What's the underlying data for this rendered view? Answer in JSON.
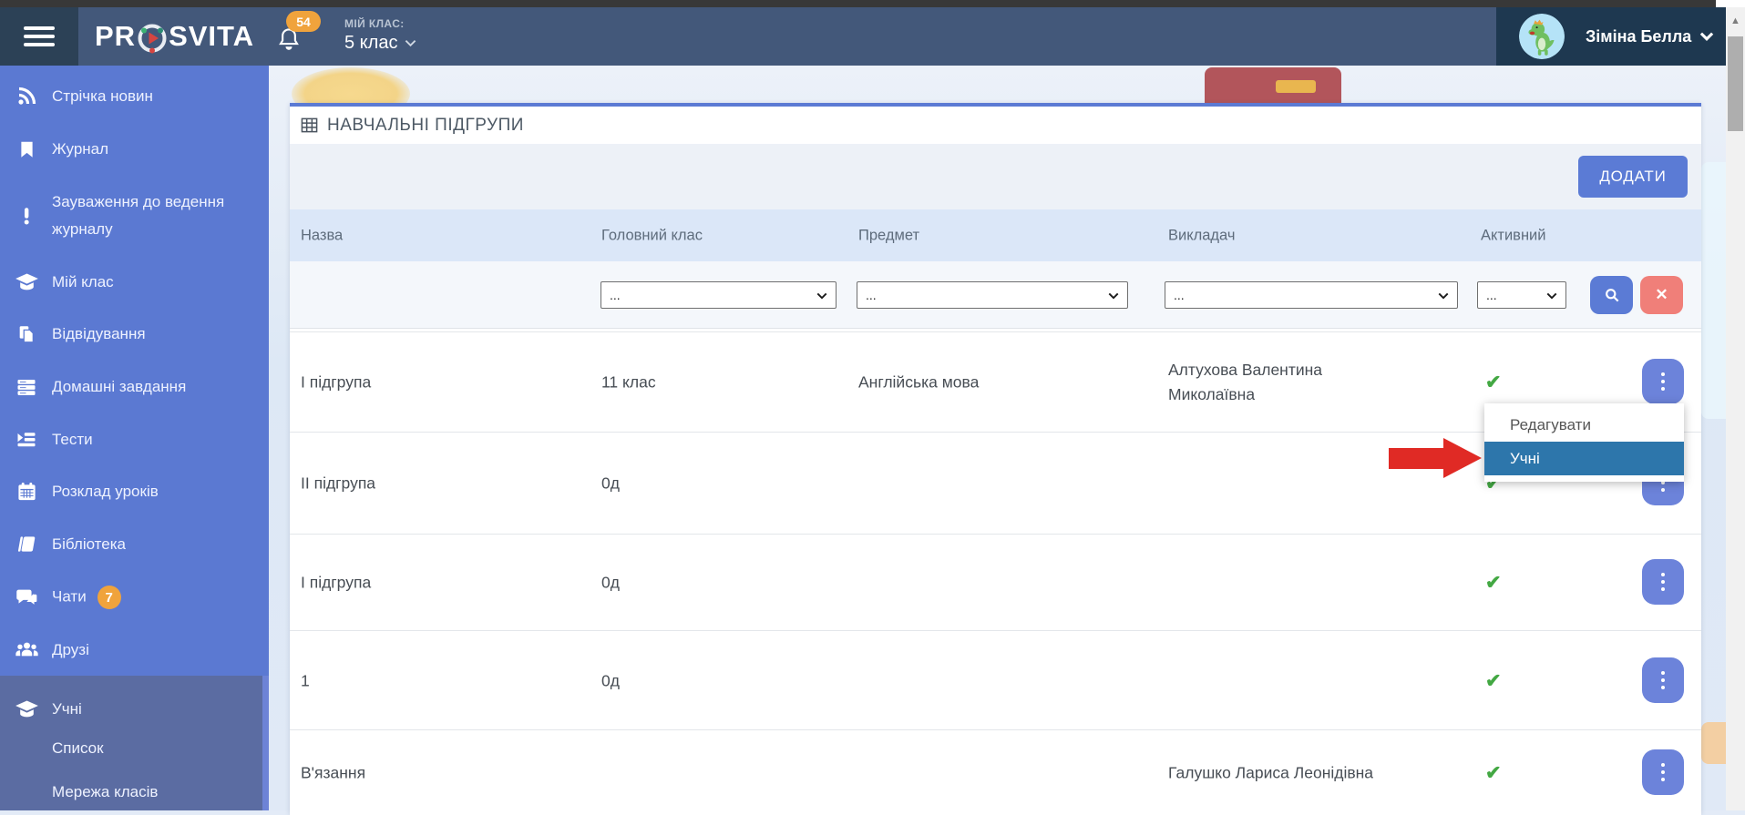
{
  "chrome": {
    "scroll_up_arrow": "▲"
  },
  "header": {
    "logo_pre": "PR",
    "logo_post": "SVITA",
    "notification_count": "54",
    "class_label": "МІЙ КЛАС:",
    "class_value": "5 клас",
    "user_name": "Зіміна Белла"
  },
  "sidebar": {
    "items": [
      {
        "label": "Стрічка новин",
        "icon": "rss-icon"
      },
      {
        "label": "Журнал",
        "icon": "bookmark-icon"
      },
      {
        "label": "Зауваження до ведення журналу",
        "icon": "exclamation-icon"
      },
      {
        "label": "Мій клас",
        "icon": "graduation-cap-icon"
      },
      {
        "label": "Відвідування",
        "icon": "attendance-icon"
      },
      {
        "label": "Домашні завдання",
        "icon": "homework-icon"
      },
      {
        "label": "Тести",
        "icon": "tests-icon"
      },
      {
        "label": "Розклад уроків",
        "icon": "calendar-icon"
      },
      {
        "label": "Бібліотека",
        "icon": "library-icon"
      },
      {
        "label": "Чати",
        "icon": "chats-icon",
        "badge": "7"
      },
      {
        "label": "Друзі",
        "icon": "friends-icon"
      },
      {
        "label": "Учні",
        "icon": "graduation-cap-icon",
        "active": true,
        "subitems": [
          "Список",
          "Мережа класів"
        ]
      }
    ]
  },
  "panel": {
    "title": "НАВЧАЛЬНІ ПІДГРУПИ",
    "add_button": "ДОДАТИ"
  },
  "table": {
    "columns": [
      "Назва",
      "Головний клас",
      "Предмет",
      "Викладач",
      "Активний"
    ],
    "filter_value": "...",
    "check_glyph": "✔",
    "rows": [
      {
        "name": "І підгрупа",
        "main_class": "11 клас",
        "subject": "Англійська мова",
        "teacher": "Алтухова Валентина Миколаївна",
        "active": true
      },
      {
        "name": "ІІ підгрупа",
        "main_class": "0д",
        "subject": "",
        "teacher": "",
        "active": true
      },
      {
        "name": "І підгрупа",
        "main_class": "0д",
        "subject": "",
        "teacher": "",
        "active": true
      },
      {
        "name": "1",
        "main_class": "0д",
        "subject": "",
        "teacher": "",
        "active": true
      },
      {
        "name": "В'язання",
        "main_class": "",
        "subject": "",
        "teacher": "Галушко Лариса Леонідівна",
        "active": true
      }
    ]
  },
  "context_menu": {
    "items": [
      {
        "label": "Редагувати",
        "active": false
      },
      {
        "label": "Учні",
        "active": true
      }
    ]
  },
  "colors": {
    "header_navy": "#43587a",
    "header_dark": "#1e3850",
    "sidebar_blue": "#5b79d2",
    "sidebar_active": "#5b6ca2",
    "accent_blue": "#5b7bd5",
    "table_header_blue": "#dbe7f8",
    "menu_highlight_blue": "#2d76ab",
    "arrow_red": "#e02a25",
    "check_green": "#43a843",
    "badge_orange": "#f0a33c",
    "clear_coral": "#f07f79"
  }
}
